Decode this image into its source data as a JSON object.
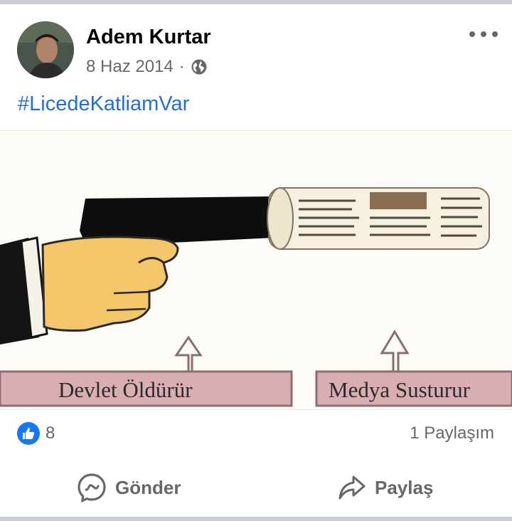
{
  "post": {
    "author": "Adem Kurtar",
    "date": "8 Haz 2014",
    "separator": "·",
    "privacy_icon": "globe-icon",
    "more_icon": "more-options-icon",
    "text": "#LicedeKatliamVar"
  },
  "image": {
    "caption_left": "Devlet Öldürür",
    "caption_right": "Medya Susturur"
  },
  "reactions": {
    "like_icon": "thumbs-up-icon",
    "like_count": "8",
    "share_count": "1 Paylaşım"
  },
  "actions": {
    "send_label": "Gönder",
    "send_icon": "messenger-icon",
    "share_label": "Paylaş",
    "share_icon": "share-arrow-icon"
  },
  "colors": {
    "accent": "#1877f2",
    "hashtag": "#216fdb",
    "secondary_text": "#65676b",
    "banner": "#d9aeb2"
  }
}
